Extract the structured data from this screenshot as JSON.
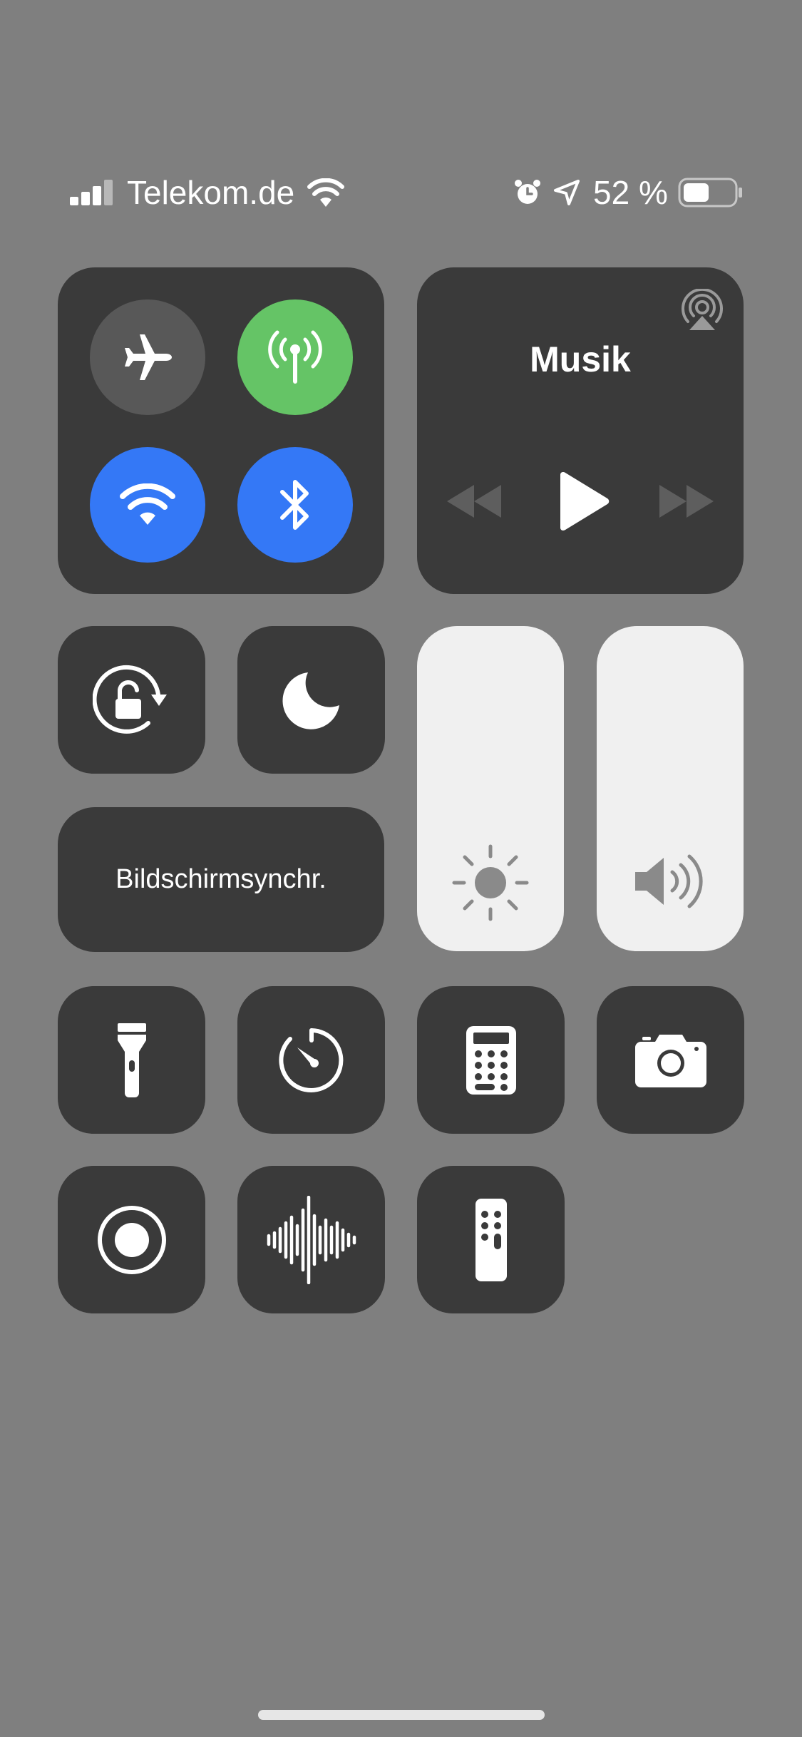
{
  "status_bar": {
    "carrier": "Telekom.de",
    "battery_percent": "52 %",
    "battery_level": 0.52,
    "signal_bars": 3,
    "icons": [
      "signal-icon",
      "wifi-icon",
      "alarm-icon",
      "location-icon",
      "battery-icon"
    ]
  },
  "connectivity": {
    "airplane": {
      "icon": "airplane-icon",
      "active": false
    },
    "cellular": {
      "icon": "cellular-antenna-icon",
      "active": true,
      "color": "#65c466"
    },
    "wifi": {
      "icon": "wifi-icon",
      "active": true,
      "color": "#3478f6"
    },
    "bluetooth": {
      "icon": "bluetooth-icon",
      "active": true,
      "color": "#3478f6"
    }
  },
  "music": {
    "title": "Musik",
    "icons": [
      "airplay-icon",
      "rewind-icon",
      "play-icon",
      "fast-forward-icon"
    ]
  },
  "controls": {
    "screen_mirroring_label": "Bildschirmsynchr.",
    "tiles": [
      "orientation-lock-icon",
      "do-not-disturb-icon",
      "flashlight-icon",
      "timer-icon",
      "calculator-icon",
      "camera-icon",
      "screen-record-icon",
      "voice-memo-icon",
      "apple-tv-remote-icon"
    ]
  },
  "sliders": {
    "brightness_icon": "brightness-sun-icon",
    "volume_icon": "speaker-volume-icon"
  },
  "colors": {
    "background": "#7f7f7f",
    "tile": "#3a3a3a",
    "green": "#65c466",
    "blue": "#3478f6",
    "slider": "#f0f0f0"
  }
}
